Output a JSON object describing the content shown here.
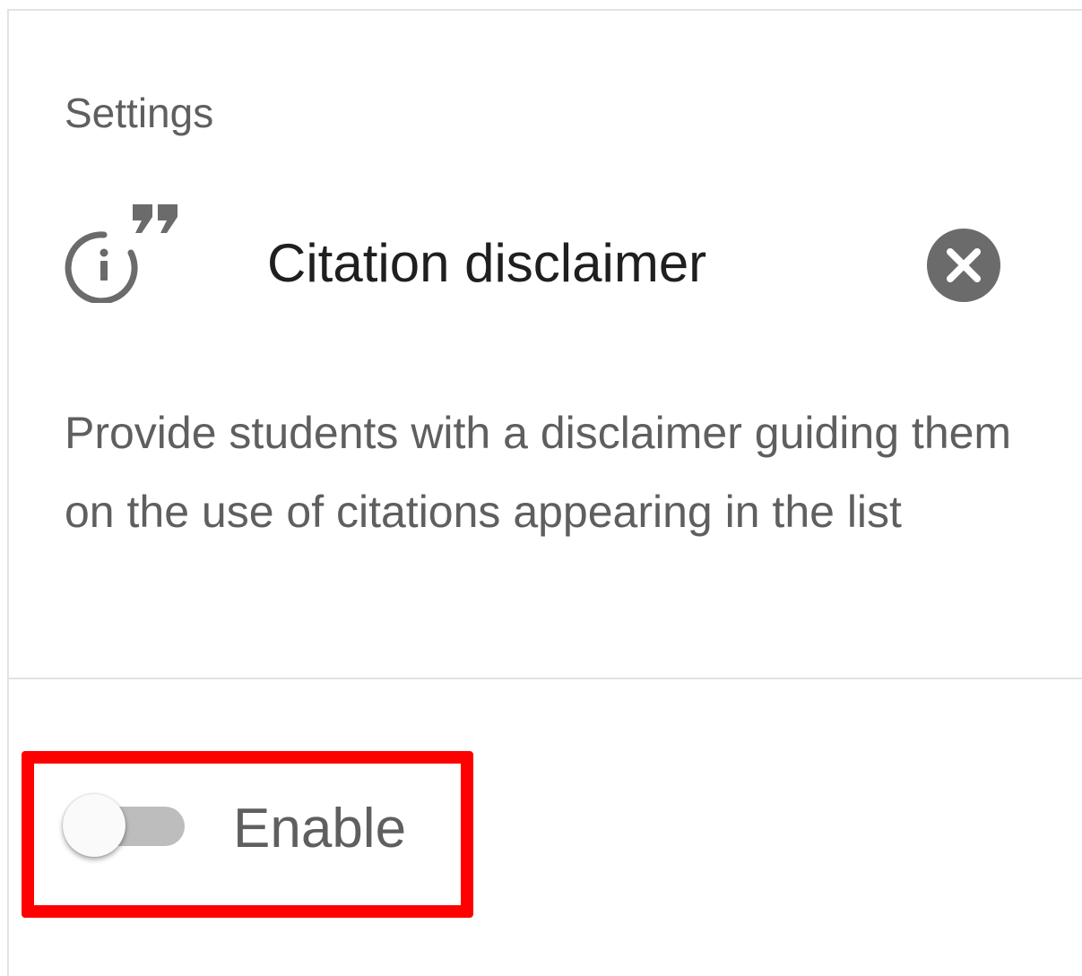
{
  "settings": {
    "title": "Settings"
  },
  "citation_disclaimer": {
    "icon": "info-quote-icon",
    "title": "Citation disclaimer",
    "close_icon": "close-circle-icon",
    "description": "Provide students with a disclaimer guiding them on the use of citations appearing in the list"
  },
  "enable_toggle": {
    "label": "Enable",
    "checked": false
  },
  "colors": {
    "highlight": "#ff0000",
    "icon_gray": "#6b6b6b",
    "text_dark": "#1f1f1f",
    "text_gray": "#5f5f5f",
    "toggle_track": "#bdbdbd",
    "divider": "#e3e3e3"
  }
}
